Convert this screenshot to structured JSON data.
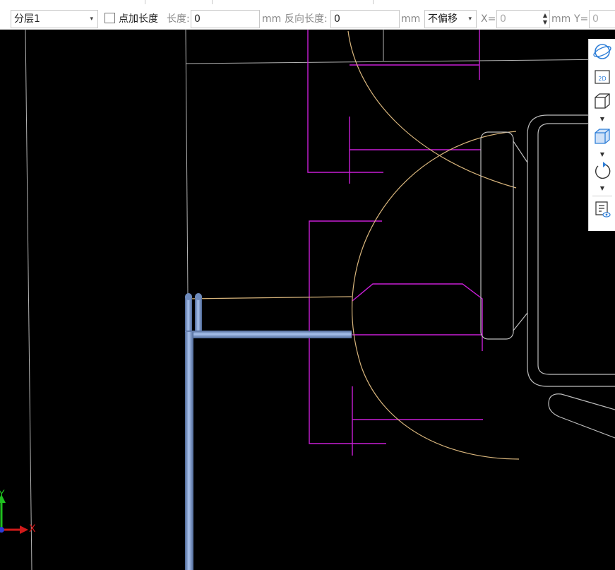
{
  "toolbar": {
    "layer_select": {
      "value": "分层1"
    },
    "add_length_checkbox": {
      "label": "点加长度",
      "checked": false
    },
    "length": {
      "label": "长度:",
      "value": "0",
      "unit": "mm"
    },
    "reverse_length": {
      "label": "反向长度:",
      "value": "0",
      "unit": "mm"
    },
    "offset_select": {
      "value": "不偏移"
    },
    "x_field": {
      "label": "X=",
      "value": "0",
      "unit": "mm"
    },
    "y_field": {
      "label": "Y=",
      "value": "0"
    }
  },
  "view_toolbar": {
    "icons": [
      "orbit-icon",
      "view-2d-icon",
      "wireframe-cube-icon",
      "shaded-cube-icon",
      "rotate-icon",
      "visibility-list-icon"
    ],
    "view_2d_text": "2D"
  },
  "axis_indicator": {
    "x_label": "X",
    "y_label": "Y"
  },
  "colors": {
    "canvas_background": "#000000",
    "magenta_lines": "#c81ed6",
    "arc_lines": "#d8b57c",
    "outline_lines": "#b9b9b9",
    "pipe": "#7f9fd6",
    "accent": "#2f7fd8"
  }
}
